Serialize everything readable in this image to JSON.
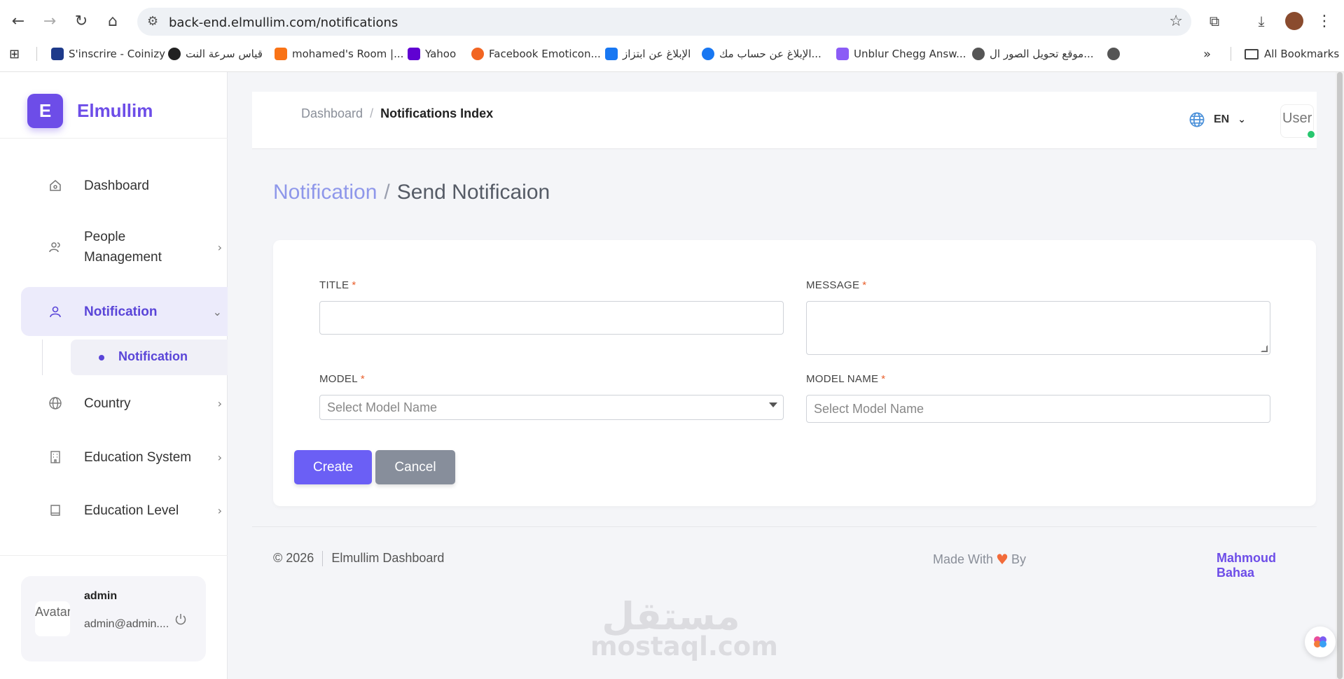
{
  "browser": {
    "url": "back-end.elmullim.com/notifications",
    "bookmarks": [
      {
        "label": "S'inscrire - Coinizy",
        "color": "#1e3a8a"
      },
      {
        "label": "قياس سرعة النت",
        "color": "#222222"
      },
      {
        "label": "mohamed's Room |...",
        "color": "#f97316"
      },
      {
        "label": "Yahoo",
        "color": "#6001d2"
      },
      {
        "label": "Facebook Emoticon...",
        "color": "#f26522"
      },
      {
        "label": "الإبلاغ عن ابتزاز",
        "color": "#1877f2"
      },
      {
        "label": "الإبلاغ عن حساب مك...",
        "color": "#1877f2"
      },
      {
        "label": "Unblur Chegg Answ...",
        "color": "#8b5cf6"
      },
      {
        "label": "موقع تحويل الصور ال...",
        "color": "#555555"
      }
    ],
    "all_bookmarks": "All Bookmarks"
  },
  "sidebar": {
    "logo_letter": "E",
    "brand": "Elmullim",
    "items": [
      {
        "label": "Dashboard"
      },
      {
        "label": "People Management"
      },
      {
        "label": "Notification"
      },
      {
        "label": "Country"
      },
      {
        "label": "Education System"
      },
      {
        "label": "Education Level"
      }
    ],
    "sub_item": "Notification",
    "user": {
      "name": "admin",
      "email": "admin@admin....",
      "avatar_alt": "Avatar"
    }
  },
  "topbar": {
    "breadcrumb": [
      "Dashboard",
      "Notifications Index"
    ],
    "language": "EN",
    "user_alt": "User"
  },
  "page": {
    "heading_section": "Notification",
    "heading_page": "Send Notificaion"
  },
  "form": {
    "title_label": "TITLE",
    "message_label": "MESSAGE",
    "model_label": "MODEL",
    "model_name_label": "MODEL NAME",
    "required_mark": "*",
    "model_placeholder": "Select Model Name",
    "model_name_placeholder": "Select Model Name",
    "create_label": "Create",
    "cancel_label": "Cancel"
  },
  "footer": {
    "copyright": "© 2026",
    "app_name": "Elmullim Dashboard",
    "made_with": "Made With",
    "by": "By",
    "author": "Mahmoud Bahaa"
  },
  "watermark": {
    "arabic": "مستقل",
    "latin": "mostaql.com"
  },
  "colors": {
    "accent": "#6d4de8",
    "button_primary": "#6b5ff5",
    "button_secondary": "#878e9b",
    "heart": "#f26b3a",
    "online": "#28c76f"
  }
}
